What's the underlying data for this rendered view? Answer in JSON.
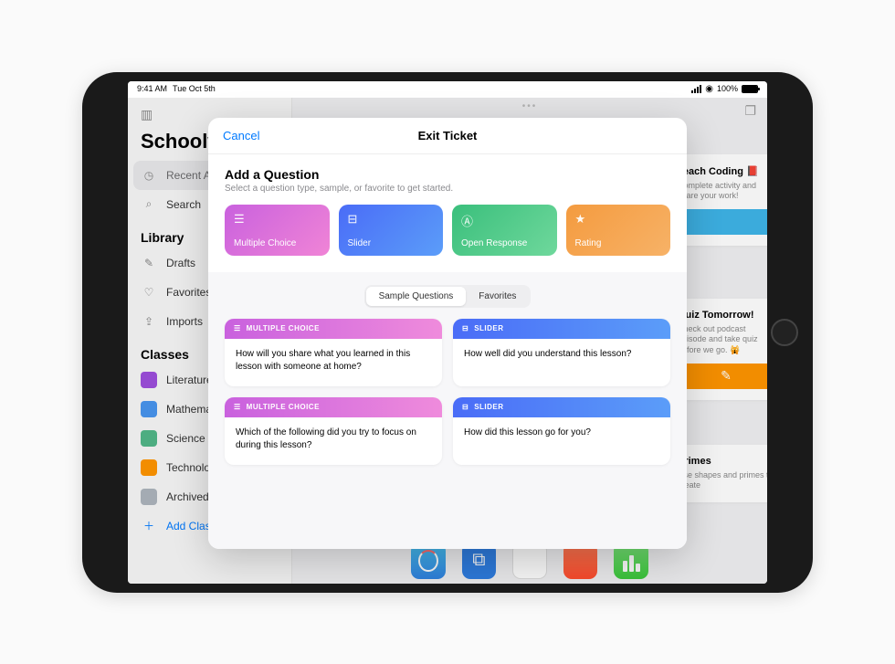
{
  "status": {
    "time": "9:41 AM",
    "date": "Tue Oct 5th",
    "battery": "100%"
  },
  "sidebar": {
    "title": "Schoolwork",
    "nav": {
      "recent": "Recent Activity",
      "search": "Search"
    },
    "library": {
      "header": "Library",
      "drafts": "Drafts",
      "favorites": "Favorites",
      "imports": "Imports"
    },
    "classes": {
      "header": "Classes",
      "lit": "Literature",
      "math": "Mathematics",
      "sci": "Science",
      "tech": "Technology",
      "arch": "Archived",
      "add": "Add Class"
    }
  },
  "bg_cards": {
    "c1_title": "Teach Coding 📕",
    "c1_text": "Complete activity and share your work!",
    "c2_title": "Quiz Tomorrow!",
    "c2_text": "Check out podcast episode and take quiz before we go. 🙀",
    "c3_title": "Primes",
    "c3_text": "Use shapes and primes to create"
  },
  "modal": {
    "cancel": "Cancel",
    "title": "Exit Ticket",
    "add_title": "Add a Question",
    "add_sub": "Select a question type, sample, or favorite to get started.",
    "types": {
      "mc": "Multiple Choice",
      "sl": "Slider",
      "or": "Open Response",
      "rt": "Rating"
    },
    "tabs": {
      "sample": "Sample Questions",
      "fav": "Favorites"
    },
    "labels": {
      "mc": "MULTIPLE CHOICE",
      "sl": "SLIDER"
    },
    "samples": {
      "q1": "How will you share what you learned in this lesson with someone at home?",
      "q2": "How well did you understand this lesson?",
      "q3": "Which of the following did you try to focus on during this lesson?",
      "q4": "How did this lesson go for you?"
    }
  }
}
